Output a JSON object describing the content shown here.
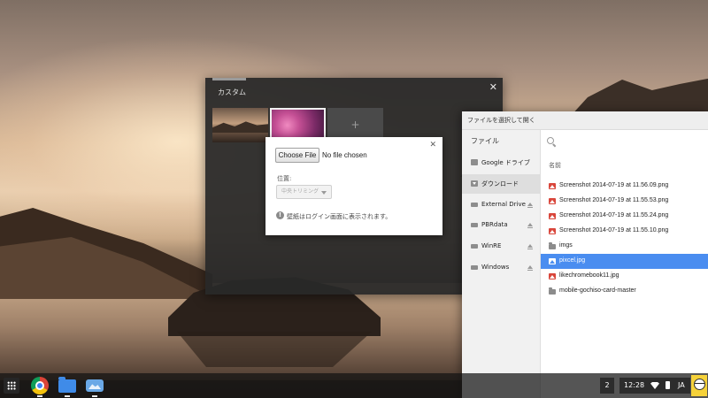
{
  "wallpaper_picker": {
    "title": "カスタム",
    "close_glyph": "✕",
    "add_glyph": "+"
  },
  "custom_dialog": {
    "close_glyph": "✕",
    "choose_file_label": "Choose File",
    "no_file_text": "No file chosen",
    "position_label": "位置:",
    "position_value": "中央トリミング",
    "info_glyph": "!",
    "info_text": "壁紙はログイン画面に表示されます。"
  },
  "file_picker": {
    "title": "ファイルを選択して開く",
    "sidebar_title": "ファイル",
    "nav_items": [
      {
        "label": "Google ドライブ",
        "icon": "google-drive-icon",
        "eject": false
      },
      {
        "label": "ダウンロード",
        "icon": "download-folder-icon",
        "eject": false,
        "selected": true
      },
      {
        "label": "External Drive",
        "icon": "drive-icon",
        "eject": true
      },
      {
        "label": "PBRdata",
        "icon": "drive-icon",
        "eject": true
      },
      {
        "label": "WinRE",
        "icon": "drive-icon",
        "eject": true
      },
      {
        "label": "Windows",
        "icon": "drive-icon",
        "eject": true
      }
    ],
    "column_header": "名前",
    "files": [
      {
        "name": "Screenshot 2014-07-19 at 11.56.09.png",
        "type": "image"
      },
      {
        "name": "Screenshot 2014-07-19 at 11.55.53.png",
        "type": "image"
      },
      {
        "name": "Screenshot 2014-07-19 at 11.55.24.png",
        "type": "image"
      },
      {
        "name": "Screenshot 2014-07-19 at 11.55.10.png",
        "type": "image"
      },
      {
        "name": "imgs",
        "type": "folder"
      },
      {
        "name": "pixcel.jpg",
        "type": "image",
        "selected": true
      },
      {
        "name": "likechromebook11.jpg",
        "type": "image"
      },
      {
        "name": "mobile-gochiso-card-master",
        "type": "folder"
      }
    ]
  },
  "shelf": {
    "workspace_badge": "2",
    "clock": "12:28",
    "ime": "JA"
  },
  "colors": {
    "selection": "#4a8df0",
    "image_file_icon": "#d9463b",
    "folder_icon": "#8c8c8c"
  }
}
